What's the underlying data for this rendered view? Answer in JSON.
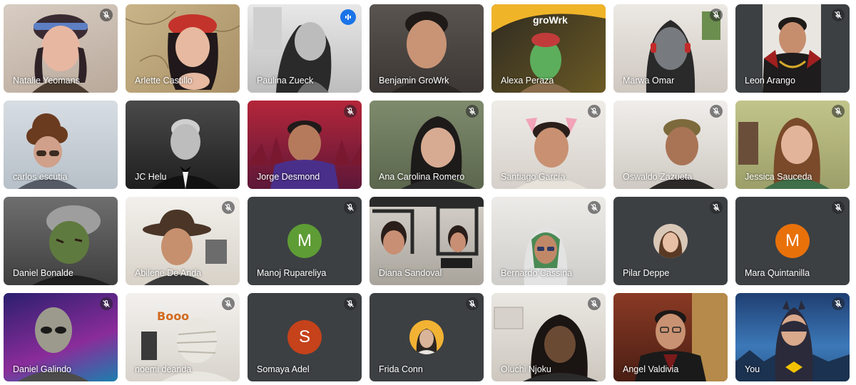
{
  "meeting": {
    "row1": [
      "Natalie Yeomans",
      "Arlette Castillo",
      "Paulina Zueck",
      "Benjamin GroWrk",
      "Alexa Peraza",
      "Marwa Omar",
      "Leon Arango"
    ],
    "row2": [
      "carlos escutia",
      "JC Helu",
      "Jorge Desmond",
      "Ana Carolina Romero",
      "Santiago García",
      "Oswaldo Zazueta",
      "Jessica Sauceda"
    ],
    "row3": [
      "Daniel Bonalde",
      "Abilene De Anda",
      "Manoj Rupareliya",
      "Diana Sandoval",
      "Bernardo Cassina",
      "Pilar Deppe",
      "Mara Quintanilla"
    ],
    "row4": [
      "Daniel Galindo",
      "noemi deanda",
      "Somaya Adel",
      "Frida Conn",
      "Oluchi Njoku",
      "Angel Valdivia",
      "You"
    ],
    "avatar_letters": {
      "manoj": "M",
      "mara": "M",
      "somaya": "S"
    },
    "logo_text": "groWrk",
    "icons": {
      "mute": "mic-off-icon",
      "speaking": "audio-level-icon"
    },
    "colors": {
      "tile_dark": "#3c4043",
      "avatar_green": "#5e9c35",
      "avatar_orange": "#e8710a",
      "avatar_red": "#c5421b",
      "speaking_border": "#8ab4f8",
      "speaking_badge": "#1a73e8"
    }
  }
}
